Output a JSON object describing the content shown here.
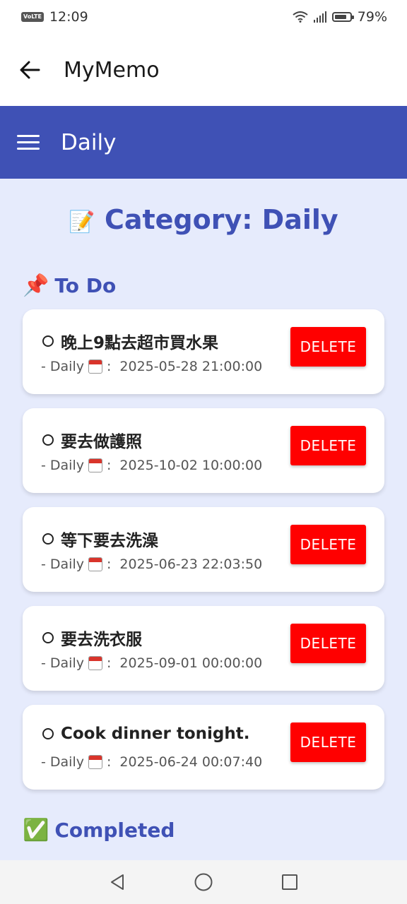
{
  "status": {
    "time": "12:09",
    "battery": "79%",
    "volte": "VoLTE"
  },
  "appbar": {
    "title": "MyMemo"
  },
  "category_bar": {
    "title": "Daily"
  },
  "main": {
    "heading": "Category: Daily",
    "heading_emoji": "📝",
    "todo": {
      "title": "To Do",
      "emoji": "📌",
      "tasks": [
        {
          "title": "晚上9點去超市買水果",
          "category": "- Daily",
          "date": "2025-05-28 21:00:00",
          "delete_label": "DELETE"
        },
        {
          "title": "要去做護照",
          "category": "- Daily",
          "date": "2025-10-02 10:00:00",
          "delete_label": "DELETE"
        },
        {
          "title": "等下要去洗澡",
          "category": "- Daily",
          "date": "2025-06-23 22:03:50",
          "delete_label": "DELETE"
        },
        {
          "title": "要去洗衣服",
          "category": "- Daily",
          "date": "2025-09-01 00:00:00",
          "delete_label": "DELETE"
        },
        {
          "title": "Cook dinner tonight.",
          "category": "- Daily",
          "date": "2025-06-24 00:07:40",
          "delete_label": "DELETE"
        }
      ]
    },
    "completed": {
      "title": "Completed",
      "emoji": "✅"
    }
  },
  "colors": {
    "accent": "#3f51b5",
    "background": "#e6ebfc",
    "delete": "#ff0000"
  }
}
